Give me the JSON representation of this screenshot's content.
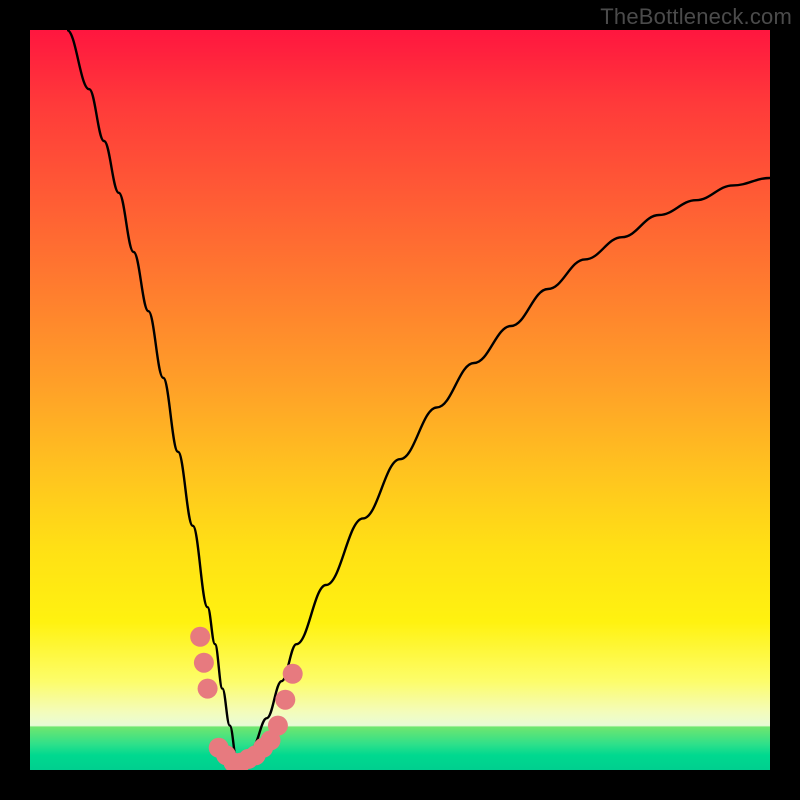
{
  "watermark": "TheBottleneck.com",
  "colors": {
    "frame": "#000000",
    "curve": "#000000",
    "marker_fill": "#e77a7f",
    "gradient_top": "#ff163f",
    "gradient_mid": "#ffe015",
    "gradient_bottom_band": "#00cf8f"
  },
  "chart_data": {
    "type": "line",
    "title": "",
    "xlabel": "",
    "ylabel": "",
    "xlim": [
      0,
      100
    ],
    "ylim": [
      0,
      100
    ],
    "note": "Values read off plot area in percent coordinates (0,0 = bottom-left of colored square). Curve is a bottleneck V-shape with minimum near x≈28, y≈0.",
    "series": [
      {
        "name": "bottleneck-curve",
        "x": [
          5,
          8,
          10,
          12,
          14,
          16,
          18,
          20,
          22,
          24,
          25,
          26,
          27,
          28,
          29,
          30,
          32,
          34,
          36,
          40,
          45,
          50,
          55,
          60,
          65,
          70,
          75,
          80,
          85,
          90,
          95,
          100
        ],
        "y": [
          100,
          92,
          85,
          78,
          70,
          62,
          53,
          43,
          33,
          22,
          17,
          11,
          6,
          1,
          1,
          3,
          7,
          12,
          17,
          25,
          34,
          42,
          49,
          55,
          60,
          65,
          69,
          72,
          75,
          77,
          79,
          80
        ]
      }
    ],
    "markers": {
      "name": "highlighted-points",
      "note": "Pink dots and short run near the valley and lower flanks",
      "points": [
        {
          "x": 23.0,
          "y": 18.0
        },
        {
          "x": 23.5,
          "y": 14.5
        },
        {
          "x": 24.0,
          "y": 11.0
        },
        {
          "x": 25.5,
          "y": 3.0
        },
        {
          "x": 26.5,
          "y": 2.0
        },
        {
          "x": 27.5,
          "y": 1.0
        },
        {
          "x": 28.5,
          "y": 1.0
        },
        {
          "x": 29.5,
          "y": 1.5
        },
        {
          "x": 30.5,
          "y": 2.0
        },
        {
          "x": 31.5,
          "y": 3.0
        },
        {
          "x": 32.5,
          "y": 4.0
        },
        {
          "x": 33.5,
          "y": 6.0
        },
        {
          "x": 34.5,
          "y": 9.5
        },
        {
          "x": 35.5,
          "y": 13.0
        }
      ]
    }
  }
}
